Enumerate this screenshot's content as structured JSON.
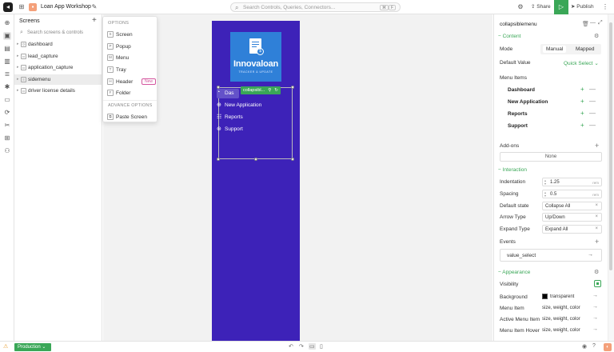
{
  "header": {
    "app_title": "Loan App Workshop",
    "search_placeholder": "Search Controls, Queries, Connectors...",
    "kbd_mod": "⌘",
    "kbd_key": "F",
    "share_label": "Share",
    "publish_label": "Publish"
  },
  "screens_panel": {
    "title": "Screens",
    "search_placeholder": "Search screens & controls",
    "items": [
      {
        "label": "dashboard",
        "icon": "Ⓓ"
      },
      {
        "label": "lead_capture",
        "icon": "▭"
      },
      {
        "label": "application_capture",
        "icon": "▭"
      },
      {
        "label": "sidemenu",
        "icon": "≡"
      },
      {
        "label": "driver license details",
        "icon": "▭"
      }
    ]
  },
  "options_menu": {
    "header": "OPTIONS",
    "items": [
      {
        "label": "Screen",
        "icon": "S"
      },
      {
        "label": "Popup",
        "icon": "P"
      },
      {
        "label": "Menu",
        "icon": "M"
      },
      {
        "label": "Tray",
        "icon": "T"
      },
      {
        "label": "Header",
        "icon": "H"
      },
      {
        "label": "Folder",
        "icon": "F"
      }
    ],
    "header_badge": "New",
    "advanced_header": "ADVANCE OPTIONS",
    "advanced_items": [
      {
        "label": "Paste Screen",
        "icon": "⧉"
      }
    ]
  },
  "canvas": {
    "brand_name": "Innovaloan",
    "brand_tagline": "TRACKER & UPDATE",
    "component_tag": "collapsibl...",
    "menu": [
      {
        "label": "Das",
        "icon": "◔"
      },
      {
        "label": "New Application",
        "icon": "⊕"
      },
      {
        "label": "Reports",
        "icon": "☷"
      },
      {
        "label": "Support",
        "icon": "⊛"
      }
    ]
  },
  "properties": {
    "component_name": "collapsiblemenu",
    "content_section": "Content",
    "mode_label": "Mode",
    "mode_options": [
      "Manual",
      "Mapped"
    ],
    "default_value_label": "Default Value",
    "default_value_link": "Quick Select",
    "menu_items_label": "Menu Items",
    "menu_items": [
      "Dashboard",
      "New Application",
      "Reports",
      "Support"
    ],
    "addons_label": "Add-ons",
    "addons_value": "None",
    "interaction_section": "Interaction",
    "indentation_label": "Indentation",
    "indentation_value": "1.25",
    "indentation_unit": "rem",
    "spacing_label": "Spacing",
    "spacing_value": "0.5",
    "spacing_unit": "rem",
    "default_state_label": "Default state",
    "default_state_value": "Collapse All",
    "arrow_type_label": "Arrow Type",
    "arrow_type_value": "Up/Down",
    "expand_type_label": "Expand Type",
    "expand_type_value": "Expand All",
    "events_label": "Events",
    "event_name": "value_select",
    "appearance_section": "Appearance",
    "visibility_label": "Visibility",
    "background_label": "Background",
    "background_value": "transparent",
    "menu_item_label": "Menu Item",
    "menu_item_value": "size, weight, color",
    "active_menu_item_label": "Active Menu Item",
    "active_menu_item_value": "size, weight, color",
    "menu_item_hover_label": "Menu Item Hover",
    "menu_item_hover_value": "size, weight, color"
  },
  "footer": {
    "environment": "Production"
  },
  "colors": {
    "accent": "#3aa757",
    "phone_bg": "#3d22b8",
    "brand_bg": "#2f80d8"
  }
}
